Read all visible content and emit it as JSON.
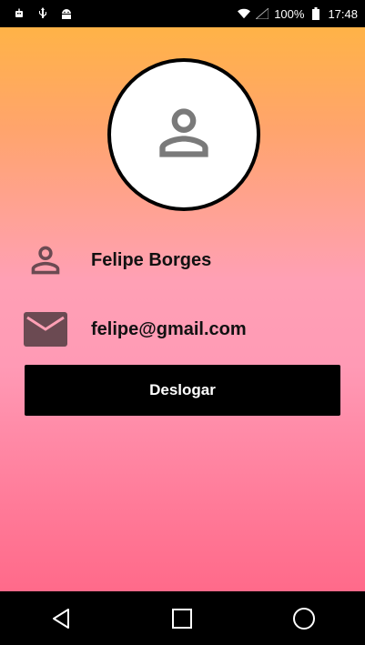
{
  "status_bar": {
    "battery": "100%",
    "time": "17:48",
    "left_icons": [
      "robot-icon",
      "usb-icon",
      "android-icon"
    ],
    "right_icons": [
      "wifi-icon",
      "signal-icon",
      "battery-icon"
    ]
  },
  "profile": {
    "avatar_icon": "person-icon",
    "name": "Felipe Borges",
    "email": "felipe@gmail.com"
  },
  "actions": {
    "logout_label": "Deslogar"
  },
  "colors": {
    "gradient_top": "#ffb347",
    "gradient_bottom": "#ff6a8a",
    "icon_gray": "#7a7a7a",
    "icon_dim": "#6b4a52"
  },
  "nav_bar": {
    "buttons": [
      "back-icon",
      "home-icon",
      "recents-icon"
    ]
  }
}
